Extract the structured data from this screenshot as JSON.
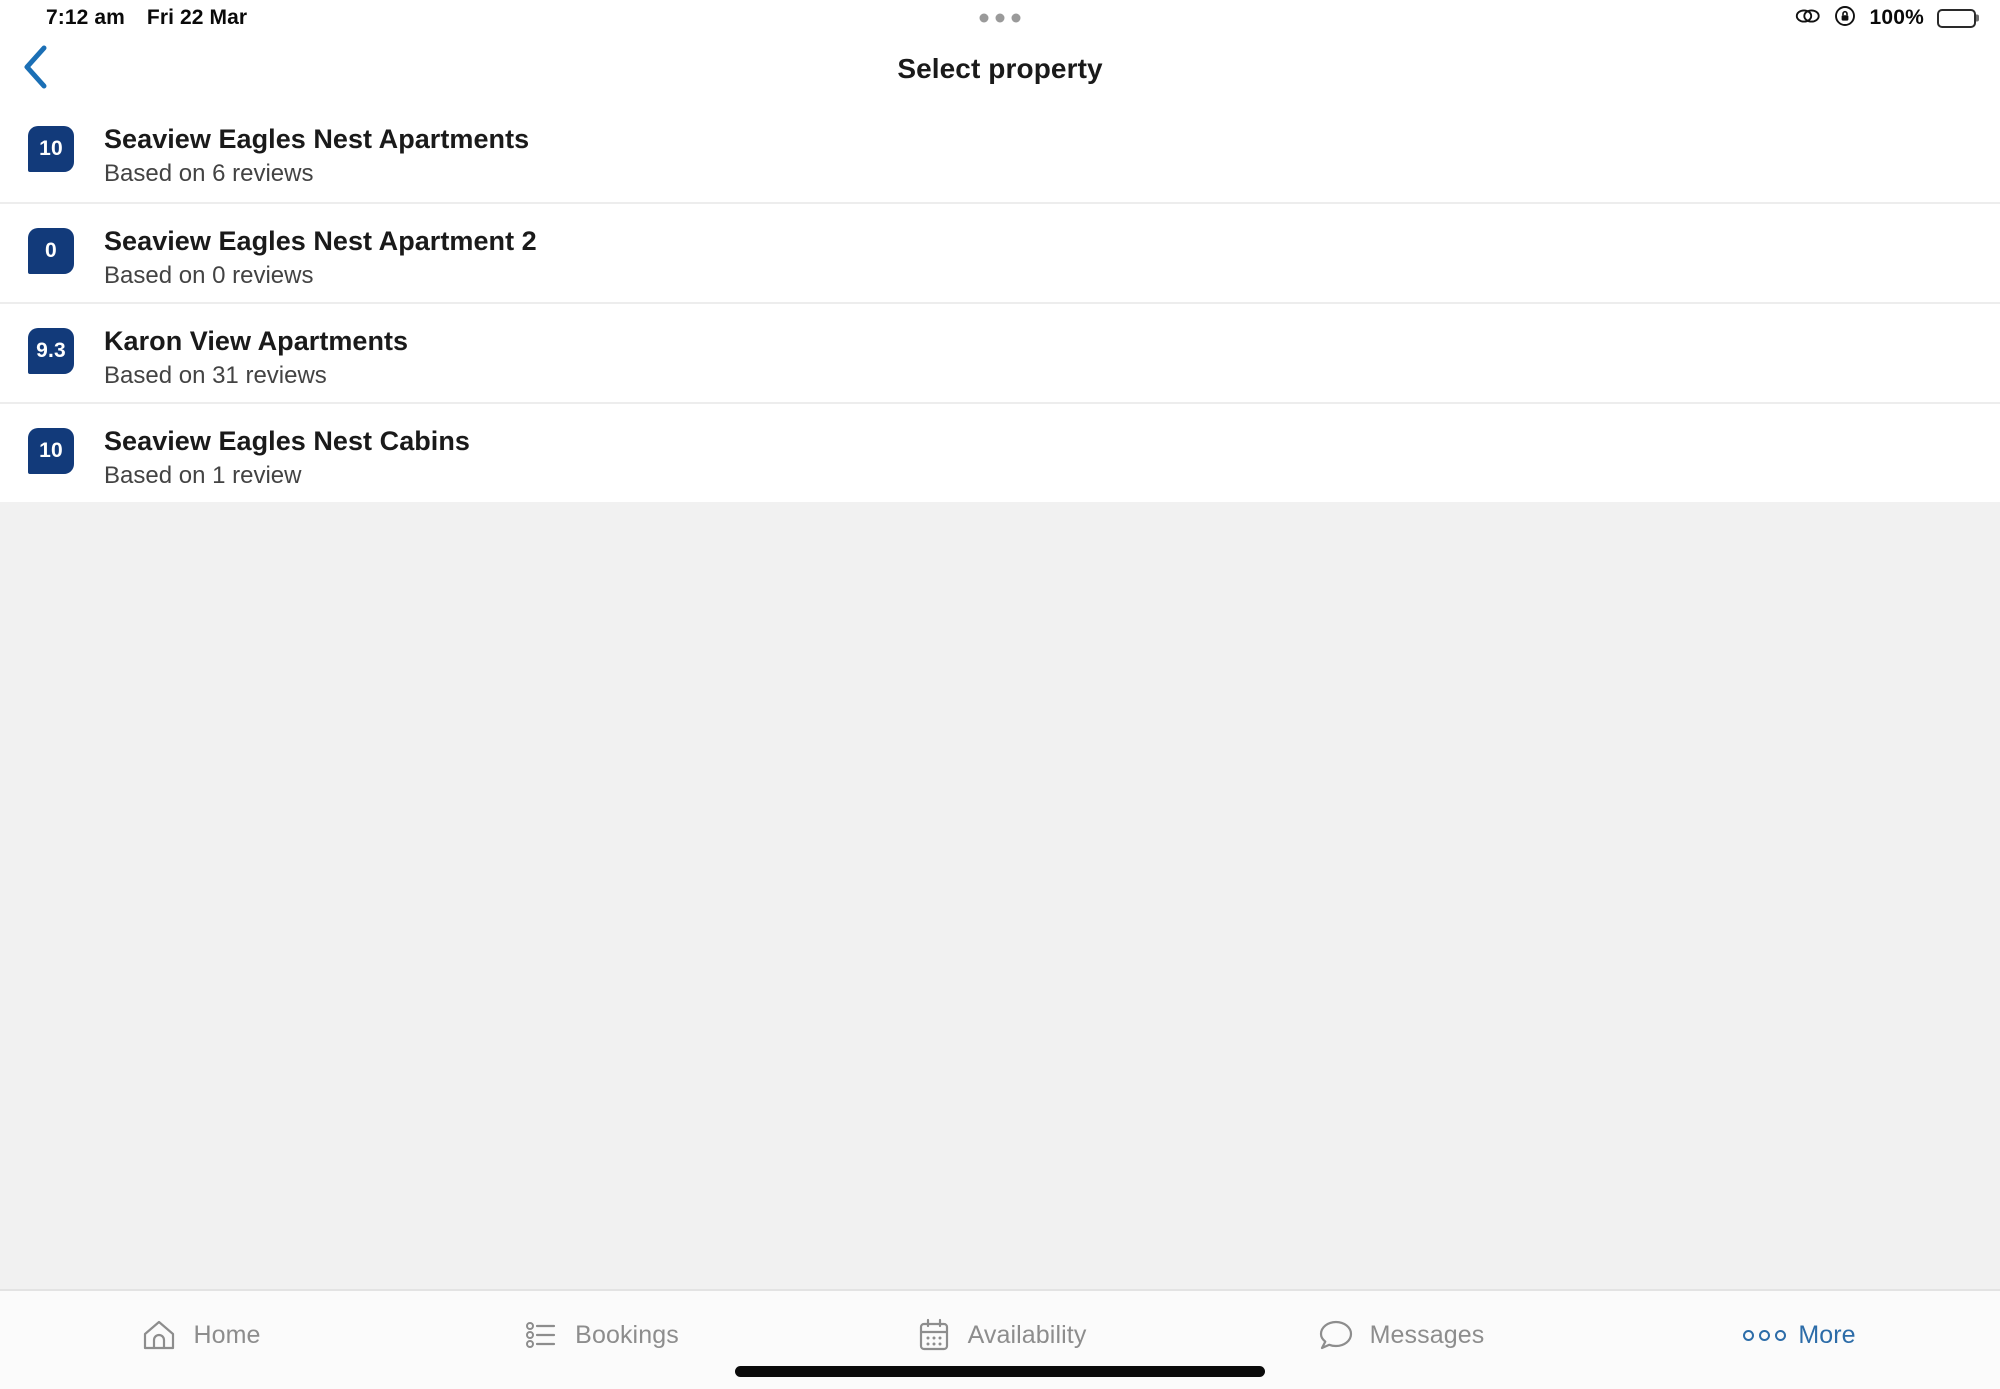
{
  "status_bar": {
    "time": "7:12 am",
    "date": "Fri 22 Mar",
    "battery_percent": "100%",
    "icons": [
      "link-icon",
      "rotation-lock-icon",
      "battery-icon"
    ],
    "multitask_handle": "multitask-handle-icon"
  },
  "header": {
    "back_icon": "chevron-left-icon",
    "title": "Select property"
  },
  "properties": [
    {
      "score": "10",
      "name": "Seaview Eagles Nest Apartments",
      "reviews": "Based on 6 reviews"
    },
    {
      "score": "0",
      "name": "Seaview Eagles Nest Apartment 2",
      "reviews": "Based on 0 reviews"
    },
    {
      "score": "9.3",
      "name": "Karon View Apartments",
      "reviews": "Based on 31 reviews"
    },
    {
      "score": "10",
      "name": "Seaview Eagles Nest Cabins",
      "reviews": "Based on 1 review"
    }
  ],
  "tab_bar": {
    "items": [
      {
        "label": "Home",
        "icon": "home-icon",
        "active": false
      },
      {
        "label": "Bookings",
        "icon": "list-icon",
        "active": false
      },
      {
        "label": "Availability",
        "icon": "calendar-icon",
        "active": false
      },
      {
        "label": "Messages",
        "icon": "chat-bubble-icon",
        "active": false
      },
      {
        "label": "More",
        "icon": "three-dots-icon",
        "active": true
      }
    ]
  },
  "colors": {
    "badge_blue": "#123a7a",
    "accent_blue": "#2c6ca8",
    "back_chevron_blue": "#1b6fb5",
    "page_background": "#f1f1f1",
    "surface": "#ffffff",
    "divider": "#ededed",
    "muted_text": "#8d8d8d"
  }
}
